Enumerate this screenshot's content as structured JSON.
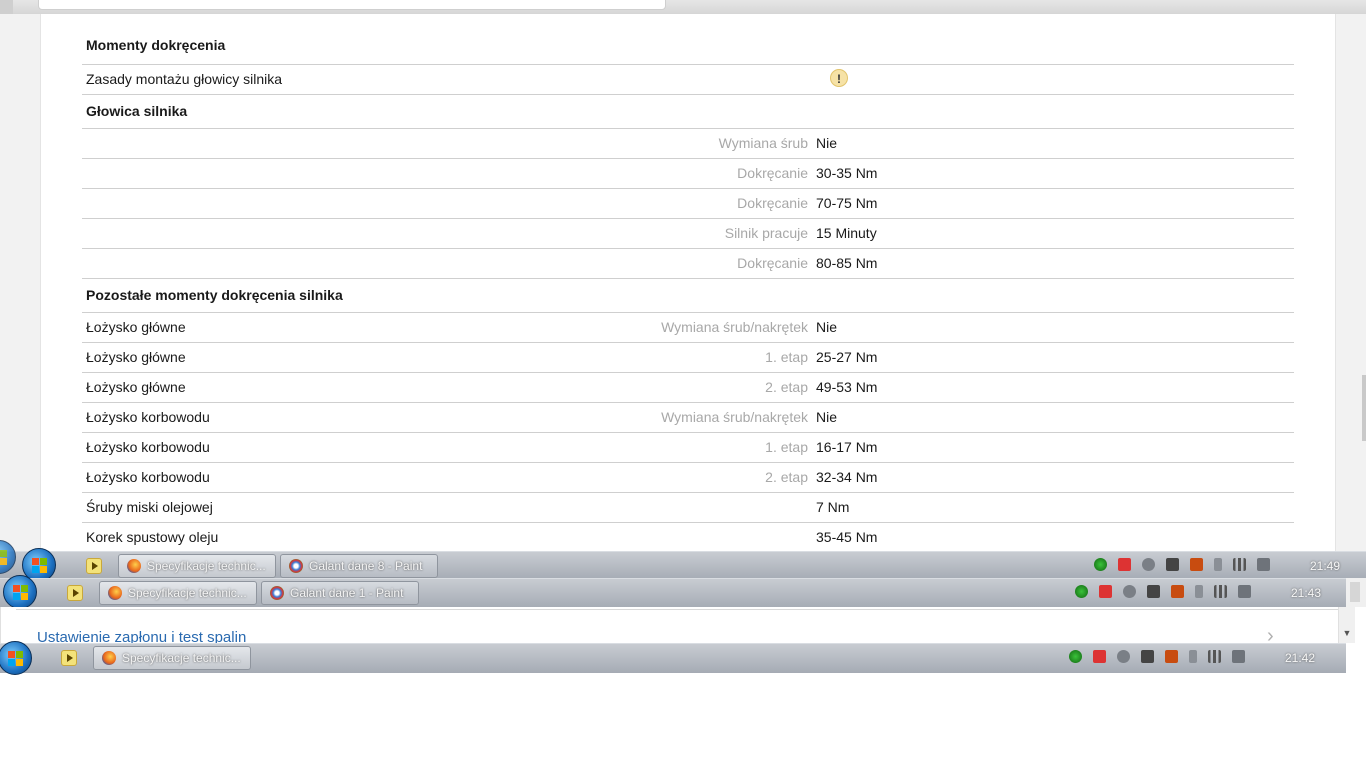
{
  "section_title": "Momenty dokręcenia",
  "rows": [
    {
      "left": "Zasady montażu głowicy silnika",
      "label": "",
      "value": "",
      "warning_icon": "exclamation-icon"
    },
    {
      "heading": "Głowica silnika"
    },
    {
      "left": "",
      "label": "Wymiana śrub",
      "value": "Nie"
    },
    {
      "left": "",
      "label": "Dokręcanie",
      "value": "30-35 Nm"
    },
    {
      "left": "",
      "label": "Dokręcanie",
      "value": "70-75 Nm"
    },
    {
      "left": "",
      "label": "Silnik pracuje",
      "value": "15 Minuty"
    },
    {
      "left": "",
      "label": "Dokręcanie",
      "value": "80-85 Nm"
    },
    {
      "heading": "Pozostałe momenty dokręcenia silnika"
    },
    {
      "left": "Łożysko główne",
      "label": "Wymiana śrub/nakrętek",
      "value": "Nie"
    },
    {
      "left": "Łożysko główne",
      "label": "1. etap",
      "value": "25-27 Nm"
    },
    {
      "left": "Łożysko główne",
      "label": "2. etap",
      "value": "49-53 Nm"
    },
    {
      "left": "Łożysko korbowodu",
      "label": "Wymiana śrub/nakrętek",
      "value": "Nie"
    },
    {
      "left": "Łożysko korbowodu",
      "label": "1. etap",
      "value": "16-17 Nm"
    },
    {
      "left": "Łożysko korbowodu",
      "label": "2. etap",
      "value": "32-34 Nm"
    },
    {
      "left": "Śruby miski olejowej",
      "label": "",
      "value": "7 Nm"
    },
    {
      "left": "Korek spustowy oleju",
      "label": "",
      "value": "35-45 Nm"
    }
  ],
  "taskbar1": {
    "tasks": [
      "Specyfikacje technic...",
      "Galant dane 8 - Paint"
    ],
    "clock": "21:49"
  },
  "taskbar2": {
    "tasks": [
      "Specyfikacje technic...",
      "Galant dane 1 - Paint"
    ],
    "clock": "21:43"
  },
  "gap": {
    "link": "Ustawienie zapłonu i test spalin"
  },
  "taskbar3": {
    "tasks": [
      "Specyfikacje technic..."
    ],
    "clock": "21:42"
  },
  "colors": {
    "label_gray": "#a8a8a8",
    "link_blue": "#2a6ab0",
    "taskbar": "#b4b9c0"
  }
}
